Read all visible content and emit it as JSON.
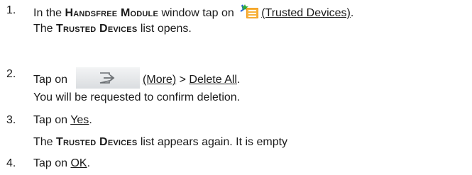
{
  "steps": [
    {
      "number": "1.",
      "text_before": "In the ",
      "window_name": "Handsfree Module",
      "text_middle": " window tap on ",
      "icon": "trusted-devices-icon",
      "link": "(Trusted Devices)",
      "text_after": ".",
      "result_before": "The ",
      "result_list": "Trusted Devices",
      "result_after": " list opens."
    },
    {
      "number": "2.",
      "text_before": "Tap on",
      "icon": "more-button-icon",
      "link_more": "(More)",
      "separator": " > ",
      "link_delete": "Delete All",
      "text_after": ".",
      "result": "You will be requested to confirm deletion."
    },
    {
      "number": "3.",
      "text_before": "Tap on ",
      "link": "Yes",
      "text_after": ".",
      "result_before": "The ",
      "result_list": "Trusted Devices",
      "result_after": " list appears again. It is empty"
    },
    {
      "number": "4.",
      "text_before": "Tap on ",
      "link": "OK",
      "text_after": "."
    }
  ],
  "colors": {
    "text": "#1a1a1a",
    "icon_green": "#2fae3a",
    "icon_orange": "#f39a1b",
    "button_gray": "#e6e8ea"
  }
}
